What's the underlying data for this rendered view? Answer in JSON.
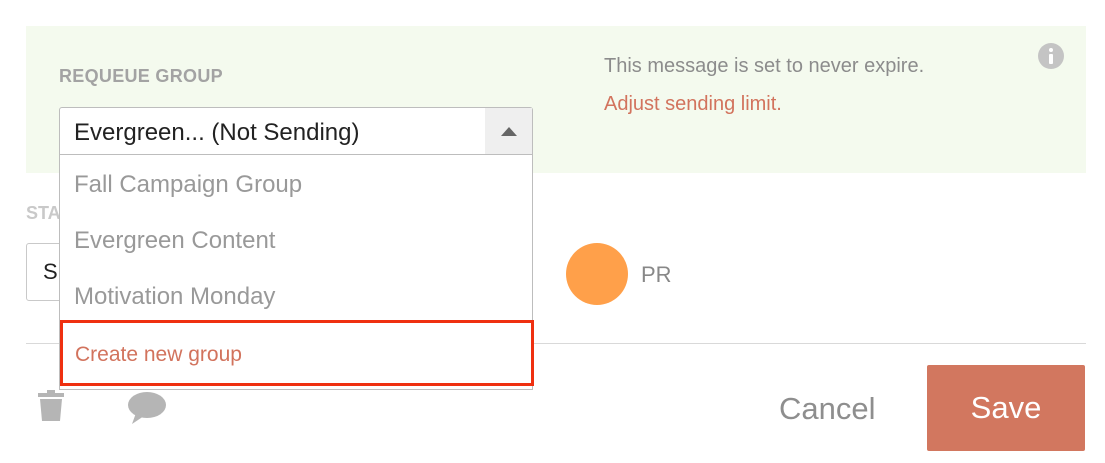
{
  "requeue": {
    "label": "REQUEUE GROUP",
    "selected": "Evergreen... (Not Sending)",
    "options": [
      "Fall Campaign Group",
      "Evergreen Content",
      "Motivation Monday"
    ],
    "create_label": "Create new group"
  },
  "expiry": {
    "message": "This message is set to never expire.",
    "link": "Adjust sending limit."
  },
  "status": {
    "label": "STA",
    "value": "S"
  },
  "author": {
    "initials": "PR",
    "avatar_color": "#ffa04a"
  },
  "footer": {
    "cancel_label": "Cancel",
    "save_label": "Save"
  },
  "colors": {
    "accent": "#d2775f",
    "panel_bg": "#f4faee",
    "highlight_border": "#ef3010"
  },
  "icons": [
    "info-icon",
    "chevron-up-icon",
    "trash-icon",
    "comment-icon"
  ]
}
